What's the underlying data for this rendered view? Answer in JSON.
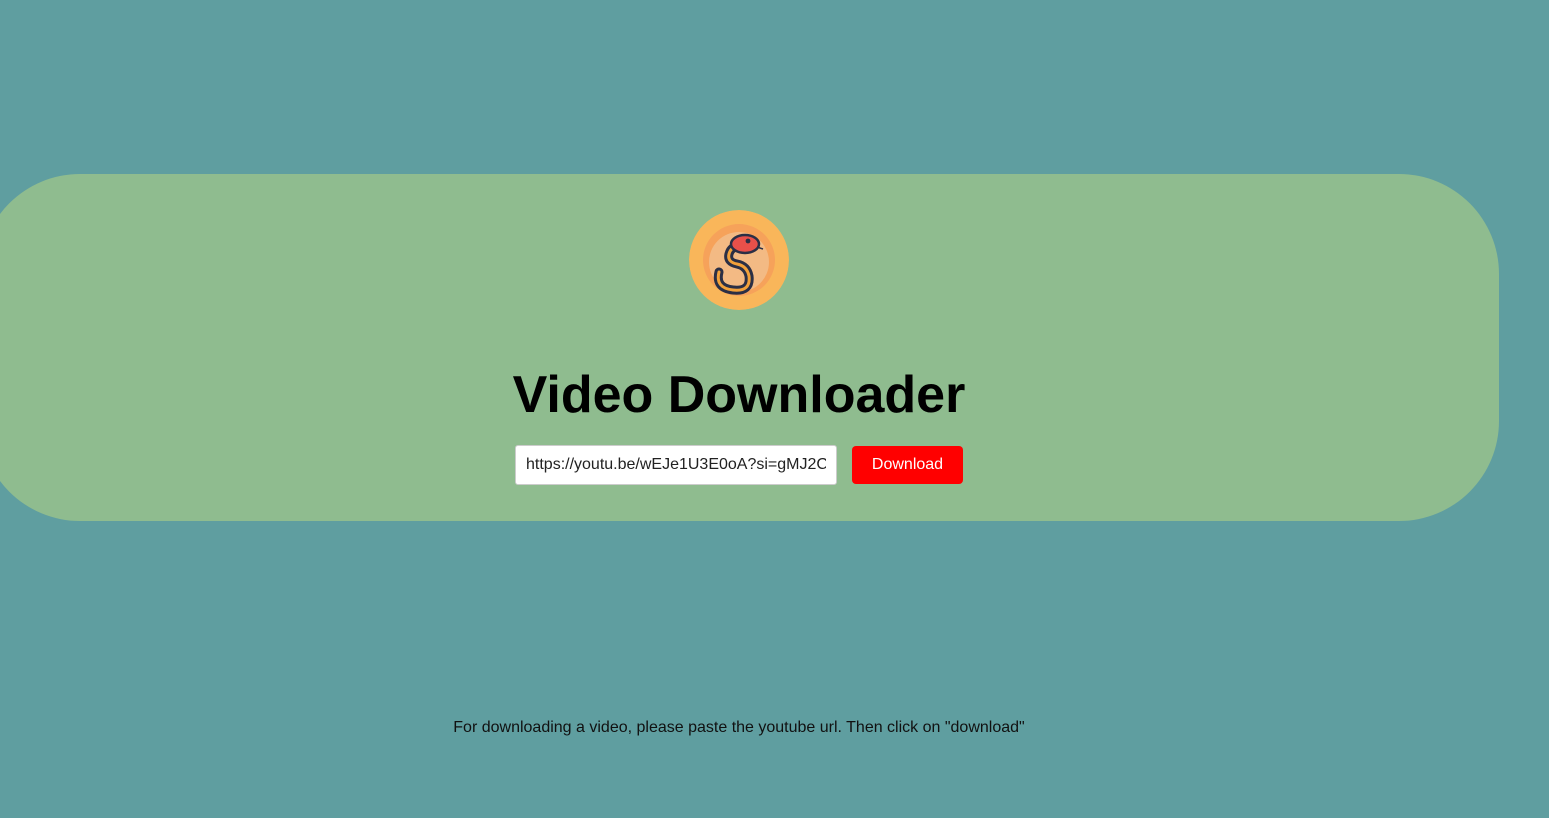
{
  "app": {
    "title": "Video Downloader",
    "logo_icon": "snake-logo-icon"
  },
  "form": {
    "url_value": "https://youtu.be/wEJe1U3E0oA?si=gMJ2C",
    "download_label": "Download"
  },
  "footer": {
    "instructions": "For downloading a video, please paste the youtube url. Then click on \"download\""
  },
  "colors": {
    "page_background": "#5f9ea0",
    "hero_background": "#8fbc8f",
    "button_background": "#ff0000",
    "logo_background": "#f9b65a"
  }
}
